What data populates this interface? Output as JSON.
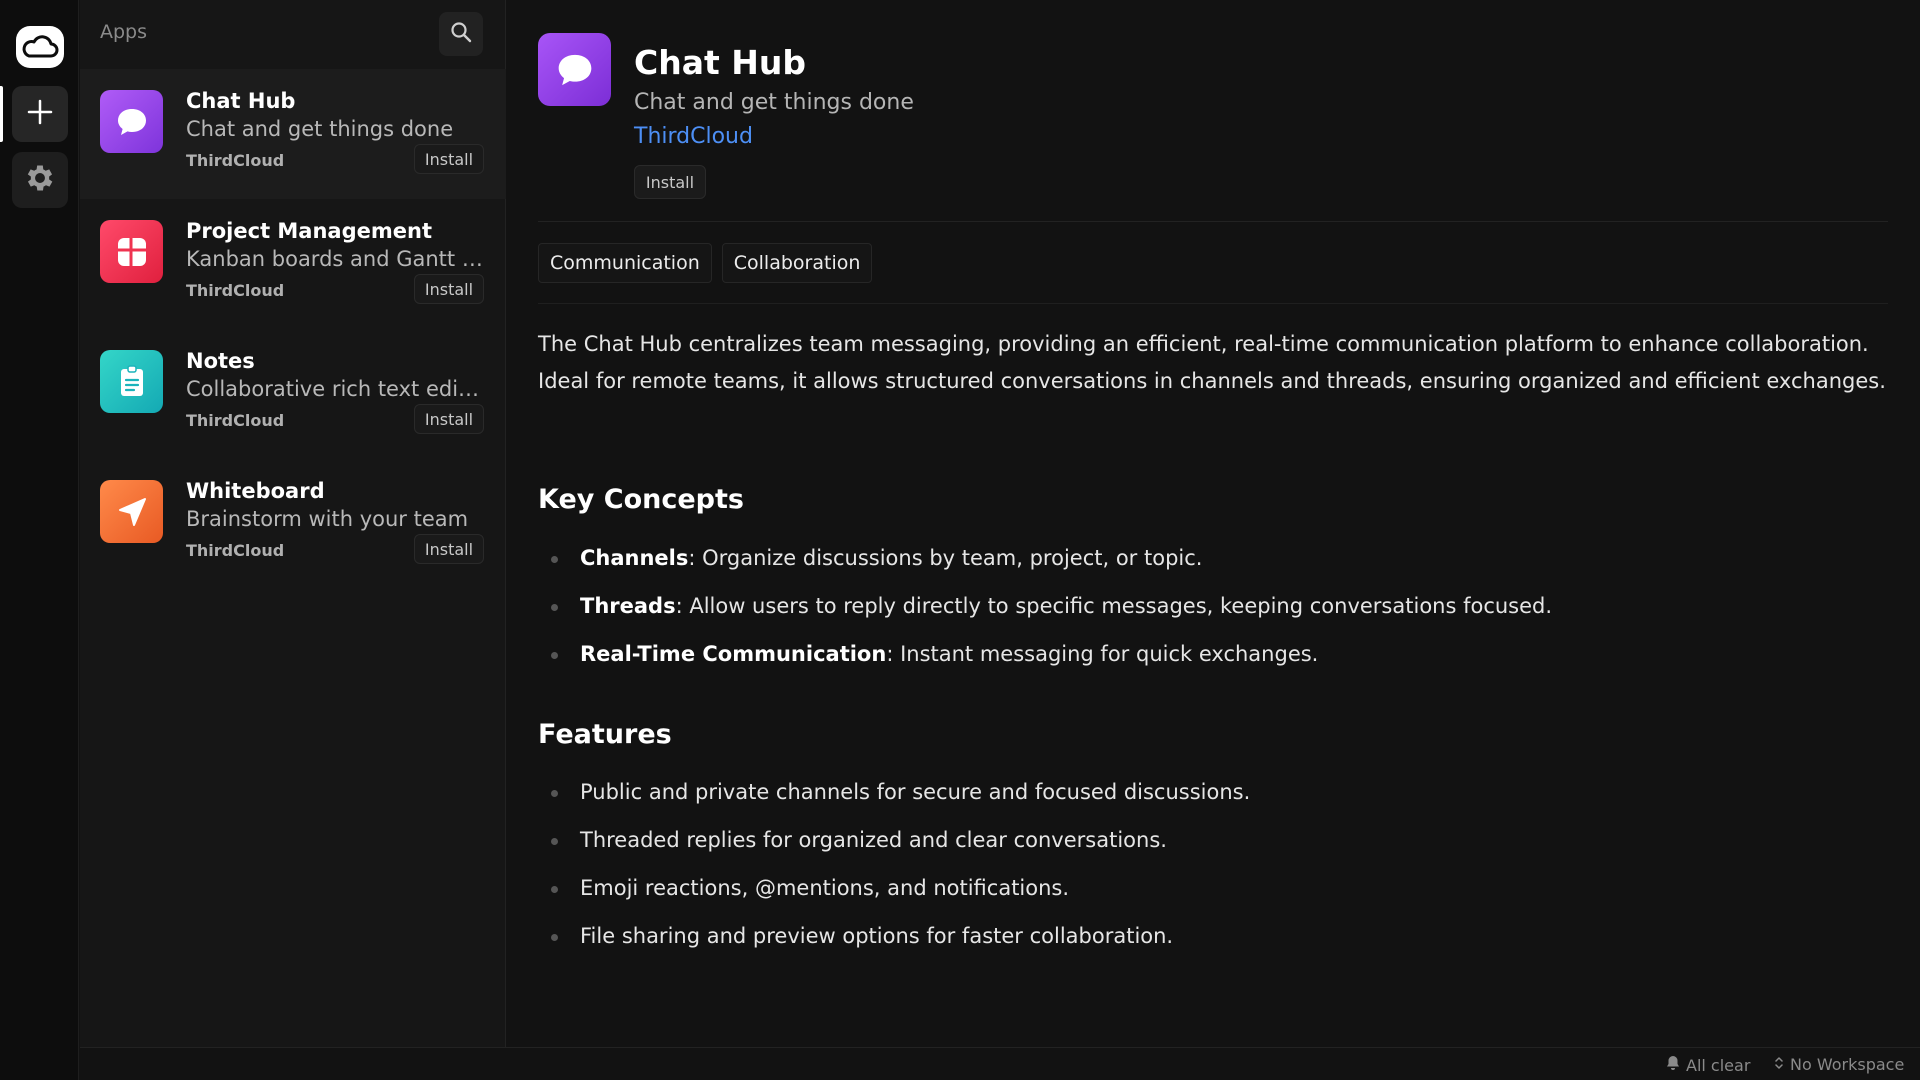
{
  "rail": {
    "logo_icon": "cloud-icon",
    "add_icon": "plus-icon",
    "settings_icon": "gear-icon"
  },
  "panel": {
    "title": "Apps",
    "search_icon": "search-icon",
    "apps": [
      {
        "name": "Chat Hub",
        "description": "Chat and get things done",
        "vendor": "ThirdCloud",
        "install_label": "Install",
        "icon": "chat-bubble-icon",
        "color": "#9b45f0"
      },
      {
        "name": "Project Management",
        "description": "Kanban boards and Gantt charts",
        "vendor": "ThirdCloud",
        "install_label": "Install",
        "icon": "grid-icon",
        "color": "#f0344f"
      },
      {
        "name": "Notes",
        "description": "Collaborative rich text editing",
        "vendor": "ThirdCloud",
        "install_label": "Install",
        "icon": "note-icon",
        "color": "#22c0c0"
      },
      {
        "name": "Whiteboard",
        "description": "Brainstorm with your team",
        "vendor": "ThirdCloud",
        "install_label": "Install",
        "icon": "send-arrow-icon",
        "color": "#f26a32"
      }
    ]
  },
  "detail": {
    "title": "Chat Hub",
    "subtitle": "Chat and get things done",
    "vendor": "ThirdCloud",
    "install_label": "Install",
    "tags": [
      "Communication",
      "Collaboration"
    ],
    "description": "The Chat Hub centralizes team messaging, providing an efficient, real-time communication platform to enhance collaboration. Ideal for remote teams, it allows structured conversations in channels and threads, ensuring organized and efficient exchanges.",
    "key_concepts_title": "Key Concepts",
    "key_concepts": [
      {
        "term": "Channels",
        "text": ": Organize discussions by team, project, or topic."
      },
      {
        "term": "Threads",
        "text": ": Allow users to reply directly to specific messages, keeping conversations focused."
      },
      {
        "term": "Real-Time Communication",
        "text": ": Instant messaging for quick exchanges."
      }
    ],
    "features_title": "Features",
    "features": [
      "Public and private channels for secure and focused discussions.",
      "Threaded replies for organized and clear conversations.",
      "Emoji reactions, @mentions, and notifications.",
      "File sharing and preview options for faster collaboration."
    ]
  },
  "statusbar": {
    "notifications": "All clear",
    "notifications_icon": "bell-icon",
    "workspace": "No Workspace",
    "workspace_icon": "chevron-updown-icon"
  }
}
